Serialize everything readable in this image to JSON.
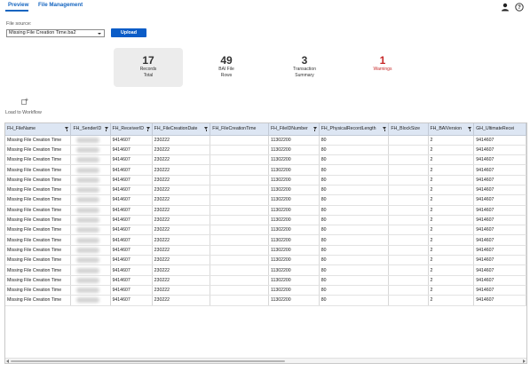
{
  "tabs": [
    {
      "label": "Preview",
      "active": true
    },
    {
      "label": "File Management",
      "active": false
    }
  ],
  "header_icons": {
    "user": "user-icon",
    "help": "help-circle-icon"
  },
  "file_source": {
    "label": "File source:",
    "selected": "Missing File Creation Time.ba2",
    "upload_label": "Upload"
  },
  "stats": [
    {
      "value": "17",
      "label": "Records\nTotal",
      "active": true
    },
    {
      "value": "49",
      "label": "BAI File\nRows",
      "active": false
    },
    {
      "value": "3",
      "label": "Transaction\nSummary",
      "active": false
    },
    {
      "value": "1",
      "label": "Warnings",
      "active": false,
      "status_color": "#c62828"
    }
  ],
  "load_to_workflow": {
    "icon": "load-workflow-icon",
    "label": "Load to Workflow"
  },
  "grid": {
    "columns": [
      "FH_FileName",
      "FH_SenderID",
      "FH_ReceiverID",
      "FH_FileCreationDate",
      "FH_FileCreationTime",
      "FH_FileIDNumber",
      "FH_PhysicalRecordLength",
      "FH_BlockSize",
      "FH_BAIVersion",
      "GH_UltimateRecei"
    ],
    "rows": [
      [
        "Missing File Creation Time",
        "",
        "9414607",
        "230222",
        "",
        "11302200",
        "80",
        "",
        "2",
        "9414607"
      ],
      [
        "Missing File Creation Time",
        "",
        "9414607",
        "230222",
        "",
        "11302200",
        "80",
        "",
        "2",
        "9414607"
      ],
      [
        "Missing File Creation Time",
        "",
        "9414607",
        "230222",
        "",
        "11302200",
        "80",
        "",
        "2",
        "9414607"
      ],
      [
        "Missing File Creation Time",
        "",
        "9414607",
        "230222",
        "",
        "11302200",
        "80",
        "",
        "2",
        "9414607"
      ],
      [
        "Missing File Creation Time",
        "",
        "9414607",
        "230222",
        "",
        "11302200",
        "80",
        "",
        "2",
        "9414607"
      ],
      [
        "Missing File Creation Time",
        "",
        "9414607",
        "230222",
        "",
        "11302200",
        "80",
        "",
        "2",
        "9414607"
      ],
      [
        "Missing File Creation Time",
        "",
        "9414607",
        "230222",
        "",
        "11302200",
        "80",
        "",
        "2",
        "9414607"
      ],
      [
        "Missing File Creation Time",
        "",
        "9414607",
        "230222",
        "",
        "11302200",
        "80",
        "",
        "2",
        "9414607"
      ],
      [
        "Missing File Creation Time",
        "",
        "9414607",
        "230222",
        "",
        "11302200",
        "80",
        "",
        "2",
        "9414607"
      ],
      [
        "Missing File Creation Time",
        "",
        "9414607",
        "230222",
        "",
        "11302200",
        "80",
        "",
        "2",
        "9414607"
      ],
      [
        "Missing File Creation Time",
        "",
        "9414607",
        "230222",
        "",
        "11302200",
        "80",
        "",
        "2",
        "9414607"
      ],
      [
        "Missing File Creation Time",
        "",
        "9414607",
        "230222",
        "",
        "11302200",
        "80",
        "",
        "2",
        "9414607"
      ],
      [
        "Missing File Creation Time",
        "",
        "9414607",
        "230222",
        "",
        "11302200",
        "80",
        "",
        "2",
        "9414607"
      ],
      [
        "Missing File Creation Time",
        "",
        "9414607",
        "230222",
        "",
        "11302200",
        "80",
        "",
        "2",
        "9414607"
      ],
      [
        "Missing File Creation Time",
        "",
        "9414607",
        "230222",
        "",
        "11302200",
        "80",
        "",
        "2",
        "9414607"
      ],
      [
        "Missing File Creation Time",
        "",
        "9414607",
        "230222",
        "",
        "11302200",
        "80",
        "",
        "2",
        "9414607"
      ],
      [
        "Missing File Creation Time",
        "",
        "9414607",
        "230222",
        "",
        "11302200",
        "80",
        "",
        "2",
        "9414607"
      ]
    ],
    "redacted_column": 1,
    "filterable_columns": [
      0,
      1,
      2,
      3,
      5,
      6,
      8
    ]
  },
  "colors": {
    "accent": "#1565c0",
    "button": "#0b5cc7",
    "warning": "#c62828",
    "header_bg": "#dde6f3"
  }
}
